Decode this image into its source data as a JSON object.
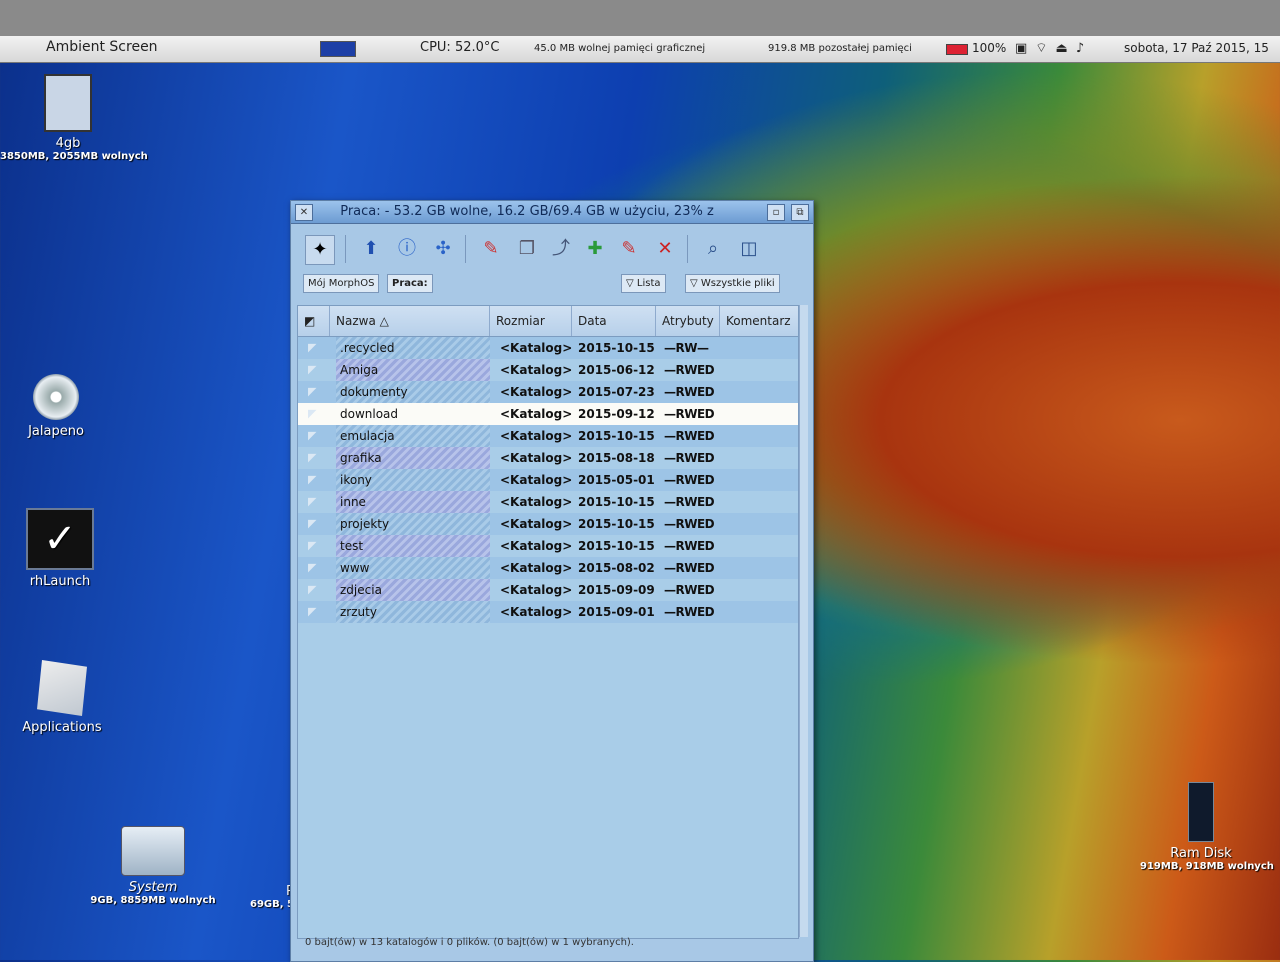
{
  "topbar": {
    "screen_name": "Ambient Screen",
    "cpu": "CPU: 52.0°C",
    "gpu_mem": "45.0 MB wolnej pamięci graficznej",
    "mem": "919.8 MB pozostałej pamięci",
    "battery": "100%",
    "datetime": "sobota, 17 Paź 2015, 15"
  },
  "desktop": {
    "icons": [
      {
        "label": "4gb",
        "sub": "3850MB, 2055MB wolnych"
      },
      {
        "label": "Jalapeno",
        "sub": ""
      },
      {
        "label": "rhLaunch",
        "sub": ""
      },
      {
        "label": "Applications",
        "sub": ""
      },
      {
        "label": "System",
        "sub": "9GB, 8859MB wolnych"
      },
      {
        "label": "P",
        "sub": "69GB, 5"
      },
      {
        "label": "Ram Disk",
        "sub": "919MB, 918MB wolnych"
      }
    ]
  },
  "window": {
    "title": "Praca: - 53.2 GB wolne, 16.2 GB/69.4 GB w użyciu, 23% z",
    "path_buttons": [
      "Mój MorphOS",
      "Praca:"
    ],
    "view_button": "Lista",
    "filter_button": "Wszystkie pliki",
    "columns": [
      "Nazwa",
      "Rozmiar",
      "Data",
      "Atrybuty",
      "Komentarz"
    ],
    "rows": [
      {
        "name": ".recycled",
        "size": "<Katalog>",
        "date": "2015-10-15",
        "attr": "—RW—"
      },
      {
        "name": "Amiga",
        "size": "<Katalog>",
        "date": "2015-06-12",
        "attr": "—RWED"
      },
      {
        "name": "dokumenty",
        "size": "<Katalog>",
        "date": "2015-07-23",
        "attr": "—RWED"
      },
      {
        "name": "download",
        "size": "<Katalog>",
        "date": "2015-09-12",
        "attr": "—RWED"
      },
      {
        "name": "emulacja",
        "size": "<Katalog>",
        "date": "2015-10-15",
        "attr": "—RWED"
      },
      {
        "name": "grafika",
        "size": "<Katalog>",
        "date": "2015-08-18",
        "attr": "—RWED"
      },
      {
        "name": "ikony",
        "size": "<Katalog>",
        "date": "2015-05-01",
        "attr": "—RWED"
      },
      {
        "name": "inne",
        "size": "<Katalog>",
        "date": "2015-10-15",
        "attr": "—RWED"
      },
      {
        "name": "projekty",
        "size": "<Katalog>",
        "date": "2015-10-15",
        "attr": "—RWED"
      },
      {
        "name": "test",
        "size": "<Katalog>",
        "date": "2015-10-15",
        "attr": "—RWED"
      },
      {
        "name": "www",
        "size": "<Katalog>",
        "date": "2015-08-02",
        "attr": "—RWED"
      },
      {
        "name": "zdjecia",
        "size": "<Katalog>",
        "date": "2015-09-09",
        "attr": "—RWED"
      },
      {
        "name": "zrzuty",
        "size": "<Katalog>",
        "date": "2015-09-01",
        "attr": "—RWED"
      }
    ],
    "status": "0 bajt(ów) w 13 katalogów i 0 plików. (0 bajt(ów) w 1 wybranych)."
  }
}
